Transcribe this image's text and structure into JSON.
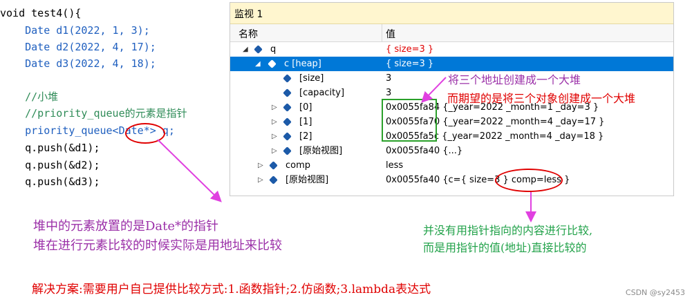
{
  "code": {
    "lines": [
      "void test4(){",
      "    Date d1(2022, 1, 3);",
      "    Date d2(2022, 4, 17);",
      "    Date d3(2022, 4, 18);",
      "",
      "    //小堆",
      "    //priority_queue的元素是指针",
      "    priority_queue<Date*> q;",
      "    q.push(&d1);",
      "    q.push(&d2);",
      "    q.push(&d3);"
    ]
  },
  "watch": {
    "title": "监视 1",
    "col_name": "名称",
    "col_value": "值",
    "rows": [
      {
        "name": "q",
        "value": "{ size=3 }",
        "expander": "◢"
      },
      {
        "name": "c [heap]",
        "value": "{ size=3 }",
        "expander": "◢"
      },
      {
        "name": "[size]",
        "value": "3",
        "expander": ""
      },
      {
        "name": "[capacity]",
        "value": "3",
        "expander": ""
      },
      {
        "name": "[0]",
        "value": "0x0055fa84 {_year=2022 _month=1 _day=3 }",
        "expander": "▷"
      },
      {
        "name": "[1]",
        "value": "0x0055fa70 {_year=2022 _month=4 _day=17 }",
        "expander": "▷"
      },
      {
        "name": "[2]",
        "value": "0x0055fa5c {_year=2022 _month=4 _day=18 }",
        "expander": "▷"
      },
      {
        "name": "[原始视图]",
        "value": "0x0055fa40 {...}",
        "expander": "▷"
      },
      {
        "name": "comp",
        "value": "less",
        "expander": "▷"
      },
      {
        "name": "[原始视图]",
        "value": "0x0055fa40 {c={ size=3 } comp=less }",
        "expander": "▷"
      }
    ]
  },
  "annotations": {
    "heap_addr": "将三个地址创建成一个大堆",
    "heap_expect": "而期望的是将三个对象创建成一个大堆",
    "compare_1": "并没有用指针指向的内容进行比较,",
    "compare_2": "而是用指针的值(地址)直接比较的",
    "elements_1": "堆中的元素放置的是Date*的指针",
    "elements_2": "堆在进行元素比较的时候实际是用地址来比较",
    "solution": "解决方案:需要用户自己提供比较方式:1.函数指针;2.仿函数;3.lambda表达式"
  },
  "watermark": "CSDN @sy2453",
  "colors": {
    "keyword": "#1f5fbf",
    "comment": "#2e8b57",
    "selection": "#0078d7",
    "annotation_red": "#e00000",
    "annotation_purple": "#9b30a8",
    "annotation_green": "#22a24a",
    "arrow_magenta": "#e040e0"
  }
}
